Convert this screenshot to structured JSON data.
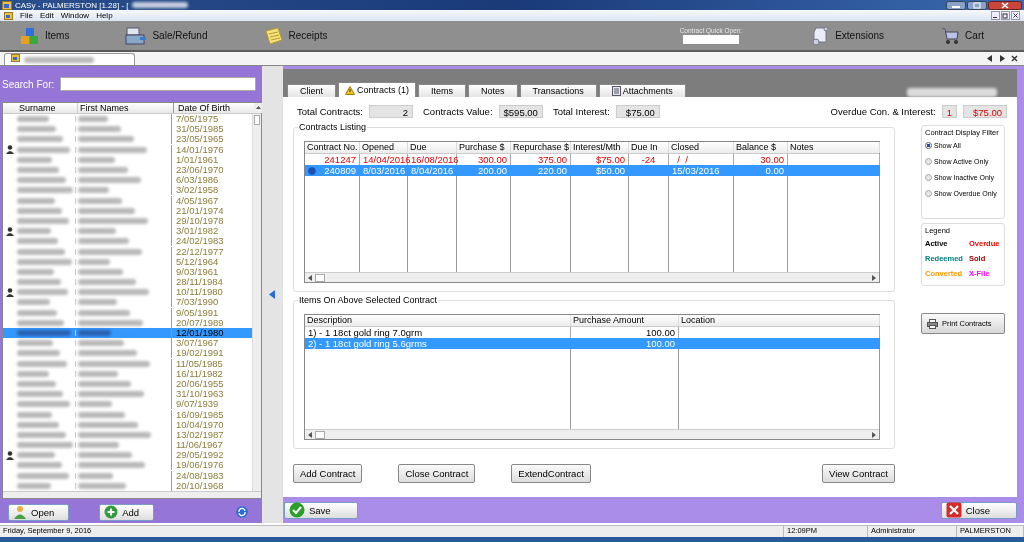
{
  "window": {
    "title": "CASy - PALMERSTON [1.28] - ["
  },
  "menu": [
    "File",
    "Edit",
    "Window",
    "Help"
  ],
  "toolbar": {
    "left": [
      {
        "kind": "items",
        "label": "Items"
      },
      {
        "kind": "register",
        "label": "Sale/Refund"
      },
      {
        "kind": "notes",
        "label": "Receipts"
      }
    ],
    "quick_open": {
      "label": "Contract Quick Open:"
    },
    "right": [
      {
        "kind": "scroll",
        "label": "Extensions"
      },
      {
        "kind": "cart",
        "label": "Cart"
      }
    ]
  },
  "client_list": {
    "search_label": "Search For:",
    "columns": [
      "Surname",
      "First Names",
      "Date Of Birth"
    ],
    "rows": [
      {
        "dob": "7/05/1975",
        "marked": false,
        "selected": false
      },
      {
        "dob": "31/05/1985",
        "marked": false,
        "selected": false
      },
      {
        "dob": "23/05/1965",
        "marked": false,
        "selected": false
      },
      {
        "dob": "14/01/1976",
        "marked": true,
        "selected": false
      },
      {
        "dob": "1/01/1961",
        "marked": false,
        "selected": false
      },
      {
        "dob": "23/06/1970",
        "marked": false,
        "selected": false
      },
      {
        "dob": "6/03/1986",
        "marked": false,
        "selected": false
      },
      {
        "dob": "3/02/1958",
        "marked": false,
        "selected": false
      },
      {
        "dob": "4/05/1967",
        "marked": false,
        "selected": false
      },
      {
        "dob": "21/01/1974",
        "marked": false,
        "selected": false
      },
      {
        "dob": "29/10/1978",
        "marked": false,
        "selected": false
      },
      {
        "dob": "3/01/1982",
        "marked": true,
        "selected": false
      },
      {
        "dob": "24/02/1983",
        "marked": false,
        "selected": false
      },
      {
        "dob": "22/12/1977",
        "marked": false,
        "selected": false
      },
      {
        "dob": "5/12/1964",
        "marked": false,
        "selected": false
      },
      {
        "dob": "9/03/1961",
        "marked": false,
        "selected": false
      },
      {
        "dob": "28/11/1984",
        "marked": false,
        "selected": false
      },
      {
        "dob": "10/11/1980",
        "marked": true,
        "selected": false
      },
      {
        "dob": "7/03/1990",
        "marked": false,
        "selected": false
      },
      {
        "dob": "9/05/1991",
        "marked": false,
        "selected": false
      },
      {
        "dob": "20/07/1989",
        "marked": false,
        "selected": false
      },
      {
        "dob": "12/01/1980",
        "marked": false,
        "selected": true
      },
      {
        "dob": "3/07/1967",
        "marked": false,
        "selected": false
      },
      {
        "dob": "19/02/1991",
        "marked": false,
        "selected": false
      },
      {
        "dob": "11/05/1985",
        "marked": false,
        "selected": false
      },
      {
        "dob": "16/11/1982",
        "marked": false,
        "selected": false
      },
      {
        "dob": "20/06/1955",
        "marked": false,
        "selected": false
      },
      {
        "dob": "31/10/1963",
        "marked": false,
        "selected": false
      },
      {
        "dob": "9/07/1939",
        "marked": false,
        "selected": false
      },
      {
        "dob": "16/09/1985",
        "marked": false,
        "selected": false
      },
      {
        "dob": "10/04/1970",
        "marked": false,
        "selected": false
      },
      {
        "dob": "13/02/1987",
        "marked": false,
        "selected": false
      },
      {
        "dob": "11/06/1967",
        "marked": false,
        "selected": false
      },
      {
        "dob": "29/05/1992",
        "marked": true,
        "selected": false
      },
      {
        "dob": "19/06/1976",
        "marked": false,
        "selected": false
      },
      {
        "dob": "24/08/1983",
        "marked": false,
        "selected": false
      },
      {
        "dob": "20/10/1968",
        "marked": false,
        "selected": false
      }
    ],
    "buttons": [
      {
        "kind": "open",
        "label": "Open"
      },
      {
        "kind": "add",
        "label": "Add"
      }
    ]
  },
  "tabs": [
    {
      "label": "Client",
      "selected": false,
      "kind": "plain"
    },
    {
      "label": "Contracts (1)",
      "selected": true,
      "kind": "warning"
    },
    {
      "label": "Items",
      "selected": false,
      "kind": "plain"
    },
    {
      "label": "Notes",
      "selected": false,
      "kind": "plain"
    },
    {
      "label": "Transactions",
      "selected": false,
      "kind": "plain"
    },
    {
      "label": "Attachments",
      "selected": false,
      "kind": "document"
    }
  ],
  "summary": [
    {
      "label": "Total Contracts:",
      "value": "2"
    },
    {
      "label": "Contracts Value:",
      "value": "$595.00"
    },
    {
      "label": "Total Interest:",
      "value": "$75.00"
    }
  ],
  "overdue": {
    "label": "Overdue Con. & Interest:",
    "count": "1",
    "amount": "$75.00"
  },
  "contracts": {
    "title": "Contracts Listing",
    "columns": [
      "Contract No.",
      "Opened",
      "Due",
      "Purchase $",
      "Repurchase $",
      "Interest/Mth",
      "Due In",
      "Closed",
      "Balance $",
      "Notes"
    ],
    "rows": [
      {
        "cells": [
          "241247",
          "14/04/2016",
          "16/08/2016",
          "300.00",
          "375.00",
          "$75.00",
          "-24",
          "  /  /",
          "30.00",
          ""
        ],
        "overdue": true,
        "selected": false,
        "current": false
      },
      {
        "cells": [
          "240809",
          "8/03/2016",
          "8/04/2016",
          "200.00",
          "220.00",
          "$50.00",
          "",
          "15/03/2016",
          "0.00",
          ""
        ],
        "overdue": false,
        "selected": true,
        "current": true
      }
    ]
  },
  "filter": {
    "title": "Contract Display Filter",
    "options": [
      {
        "label": "Show All",
        "selected": true
      },
      {
        "label": "Show Active Only",
        "selected": false
      },
      {
        "label": "Show Inactive Only",
        "selected": false
      },
      {
        "label": "Show Overdue Only",
        "selected": false
      }
    ]
  },
  "legend": {
    "title": "Legend",
    "items": [
      {
        "label": "Active",
        "color": "#000000"
      },
      {
        "label": "Overdue",
        "color": "#ff0000"
      },
      {
        "label": "Redeemed",
        "color": "#008080"
      },
      {
        "label": "Sold",
        "color": "#a00000"
      },
      {
        "label": "Converted",
        "color": "#ff9900"
      },
      {
        "label": "X-File",
        "color": "#ff00ff"
      }
    ]
  },
  "print_button": "Print Contracts",
  "items": {
    "title": "Items On Above Selected Contract",
    "columns": [
      "Description",
      "Purchase Amount",
      "Location"
    ],
    "rows": [
      {
        "cells": [
          "1) - 1 18ct gold ring 7.0grm",
          "100.00",
          ""
        ],
        "selected": false
      },
      {
        "cells": [
          "2) - 1 18ct gold ring 5.6grms",
          "100.00",
          ""
        ],
        "selected": true
      }
    ]
  },
  "actions": [
    "Add Contract",
    "Close Contract",
    "ExtendContract",
    "View Contract"
  ],
  "bottom_buttons": [
    {
      "kind": "save",
      "label": "Save"
    },
    {
      "kind": "close",
      "label": "Close"
    }
  ],
  "status_bar": {
    "date": "Friday, September 9, 2016",
    "time": "12:09PM",
    "user": "Administrator",
    "branch": "PALMERSTON"
  }
}
